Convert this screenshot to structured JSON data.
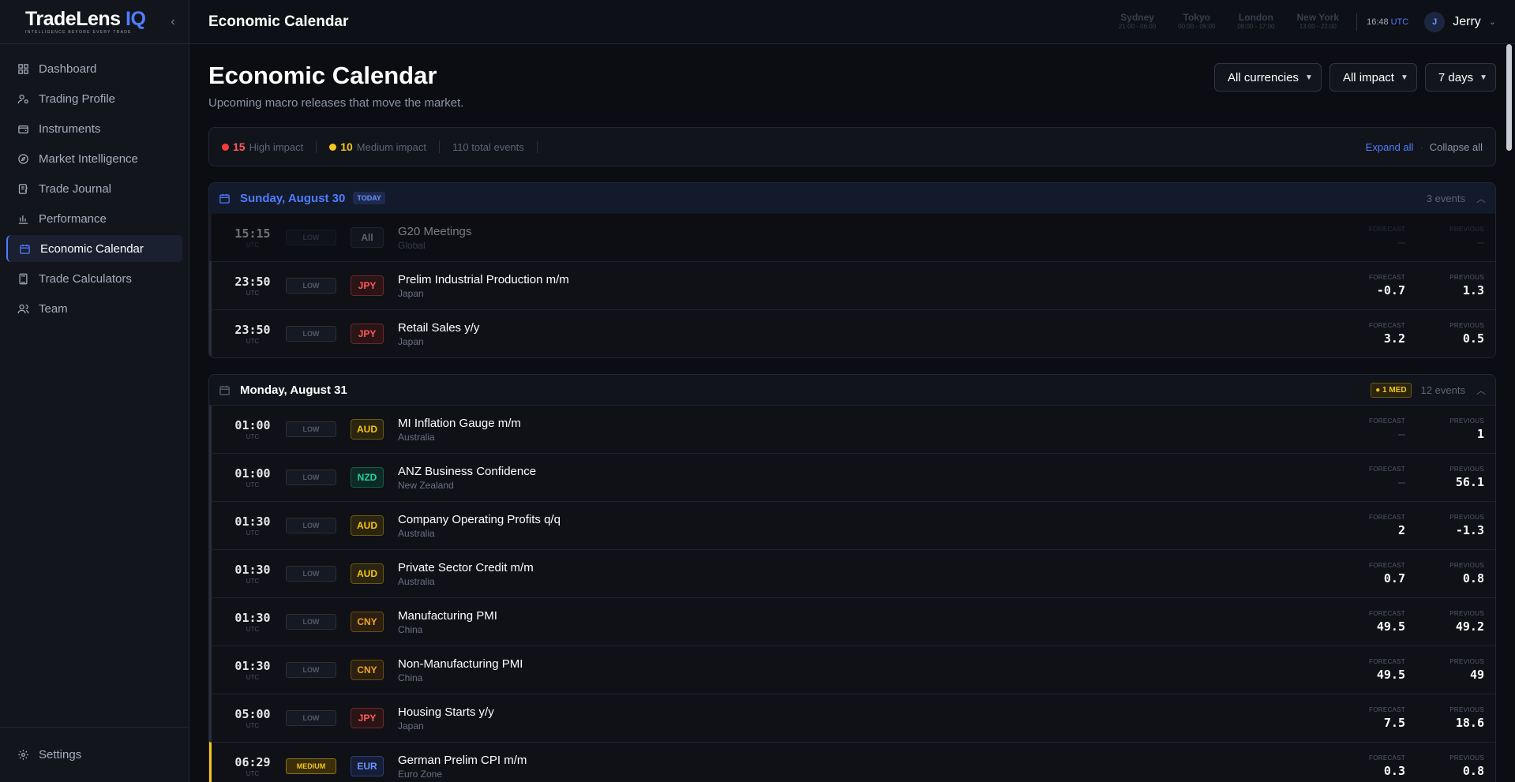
{
  "brand": {
    "name": "TradeLens",
    "suffix": "IQ",
    "tagline": "INTELLIGENCE BEFORE EVERY TRADE"
  },
  "nav": [
    {
      "label": "Dashboard",
      "icon": "grid-icon"
    },
    {
      "label": "Trading Profile",
      "icon": "user-cog-icon"
    },
    {
      "label": "Instruments",
      "icon": "wallet-icon"
    },
    {
      "label": "Market Intelligence",
      "icon": "compass-icon"
    },
    {
      "label": "Trade Journal",
      "icon": "journal-icon"
    },
    {
      "label": "Performance",
      "icon": "bar-chart-icon"
    },
    {
      "label": "Economic Calendar",
      "icon": "calendar-icon",
      "active": true
    },
    {
      "label": "Trade Calculators",
      "icon": "calculator-icon"
    },
    {
      "label": "Team",
      "icon": "users-icon"
    }
  ],
  "settings_label": "Settings",
  "topbar": {
    "title": "Economic Calendar",
    "time": "16:48",
    "utc": "UTC",
    "user_initial": "J",
    "user_name": "Jerry"
  },
  "sessions": [
    {
      "name": "Sydney",
      "hours": "21:00 - 06:00"
    },
    {
      "name": "Tokyo",
      "hours": "00:00 - 09:00"
    },
    {
      "name": "London",
      "hours": "08:00 - 17:00"
    },
    {
      "name": "New York",
      "hours": "13:00 - 22:00"
    }
  ],
  "page": {
    "title": "Economic Calendar",
    "subtitle": "Upcoming macro releases that move the market."
  },
  "filters": {
    "currency": "All currencies",
    "impact": "All impact",
    "range": "7 days"
  },
  "stats": {
    "high_count": "15",
    "high_label": "High impact",
    "medium_count": "10",
    "medium_label": "Medium impact",
    "total": "110 total events",
    "expand": "Expand all",
    "collapse": "Collapse all"
  },
  "colors": {
    "accent": "#4f7dff",
    "high": "#ff5a5a",
    "medium": "#f5c518"
  },
  "labels": {
    "utc": "UTC",
    "forecast": "FORECAST",
    "previous": "PREVIOUS"
  },
  "days": [
    {
      "title": "Sunday, August 30",
      "today_badge": "TODAY",
      "count": "3 events",
      "events": [
        {
          "time": "15:15",
          "impact": "LOW",
          "cur": "All",
          "name": "G20 Meetings",
          "country": "Global",
          "forecast": "–",
          "previous": "–",
          "dim": true
        },
        {
          "time": "23:50",
          "impact": "LOW",
          "cur": "JPY",
          "name": "Prelim Industrial Production m/m",
          "country": "Japan",
          "forecast": "-0.7",
          "previous": "1.3"
        },
        {
          "time": "23:50",
          "impact": "LOW",
          "cur": "JPY",
          "name": "Retail Sales y/y",
          "country": "Japan",
          "forecast": "3.2",
          "previous": "0.5"
        }
      ]
    },
    {
      "title": "Monday, August 31",
      "med_badge": "1 MED",
      "count": "12 events",
      "events": [
        {
          "time": "01:00",
          "impact": "LOW",
          "cur": "AUD",
          "name": "MI Inflation Gauge m/m",
          "country": "Australia",
          "forecast": "–",
          "previous": "1"
        },
        {
          "time": "01:00",
          "impact": "LOW",
          "cur": "NZD",
          "name": "ANZ Business Confidence",
          "country": "New Zealand",
          "forecast": "–",
          "previous": "56.1"
        },
        {
          "time": "01:30",
          "impact": "LOW",
          "cur": "AUD",
          "name": "Company Operating Profits q/q",
          "country": "Australia",
          "forecast": "2",
          "previous": "-1.3"
        },
        {
          "time": "01:30",
          "impact": "LOW",
          "cur": "AUD",
          "name": "Private Sector Credit m/m",
          "country": "Australia",
          "forecast": "0.7",
          "previous": "0.8"
        },
        {
          "time": "01:30",
          "impact": "LOW",
          "cur": "CNY",
          "name": "Manufacturing PMI",
          "country": "China",
          "forecast": "49.5",
          "previous": "49.2"
        },
        {
          "time": "01:30",
          "impact": "LOW",
          "cur": "CNY",
          "name": "Non-Manufacturing PMI",
          "country": "China",
          "forecast": "49.5",
          "previous": "49"
        },
        {
          "time": "05:00",
          "impact": "LOW",
          "cur": "JPY",
          "name": "Housing Starts y/y",
          "country": "Japan",
          "forecast": "7.5",
          "previous": "18.6"
        },
        {
          "time": "06:29",
          "impact": "MEDIUM",
          "cur": "EUR",
          "name": "German Prelim CPI m/m",
          "country": "Euro Zone",
          "forecast": "0.3",
          "previous": "0.8"
        }
      ]
    }
  ]
}
